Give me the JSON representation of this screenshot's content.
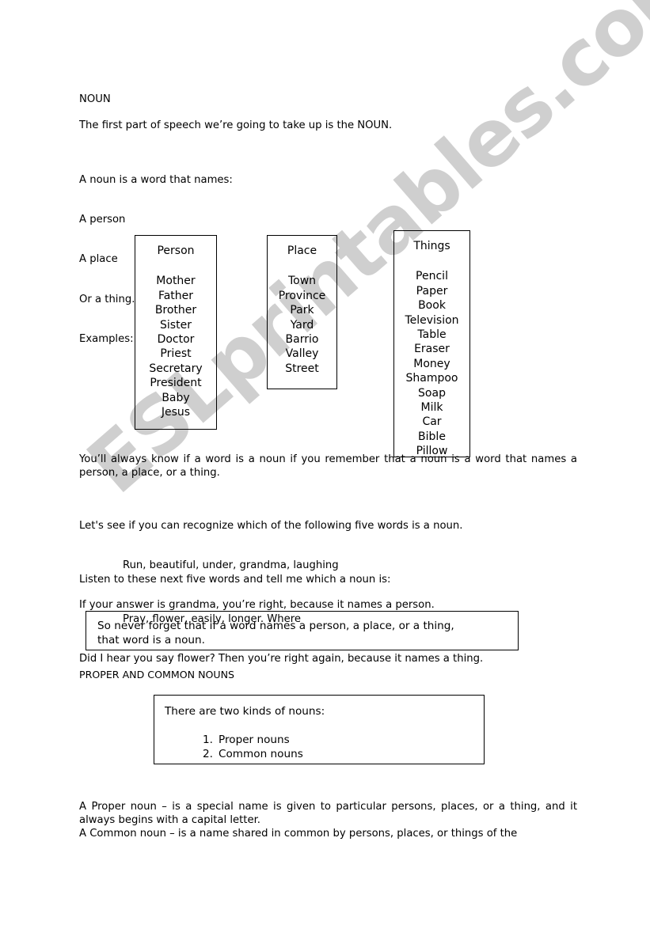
{
  "document": {
    "heading": "NOUN",
    "intro_line": "The first part of speech we’re going to take up is the NOUN.",
    "definition_lines": [
      "A noun is a word that names:",
      "A person",
      "A place",
      "Or a thing.",
      "Examples:"
    ]
  },
  "boxes": [
    {
      "title": "Person",
      "items": [
        "Mother",
        "Father",
        "Brother",
        "Sister",
        "Doctor",
        "Priest",
        "Secretary",
        "President",
        "Baby",
        "Jesus"
      ]
    },
    {
      "title": "Place",
      "items": [
        "Town",
        "Province",
        "Park",
        "Yard",
        "Barrio",
        "Valley",
        "Street"
      ]
    },
    {
      "title": "Things",
      "items": [
        "Pencil",
        "Paper",
        "Book",
        "Television",
        "Table",
        "Eraser",
        "Money",
        "Shampoo",
        "Soap",
        "Milk",
        "Car",
        "Bible",
        "Pillow"
      ]
    }
  ],
  "body": {
    "reminder": "You’ll always know if a word is a noun if you remember that a noun is a word that names a person, a place, or a thing.",
    "exercise1_prompt": "Let's see if you can recognize which of the following five words is a noun.",
    "exercise1_words": "Run, beautiful, under, grandma, laughing",
    "exercise1_answer": "If your answer is grandma, you’re right, because it names a person.",
    "exercise2_prompt": "Listen to these next five words and tell me which a noun is:",
    "exercise2_words": "Pray, flower, easily, longer. Where",
    "exercise2_answer": "Did I hear you say flower? Then you’re right again, because it names a thing."
  },
  "callout": {
    "line1": "So never forget that if a word names a person, a place, or a thing,",
    "line2": "that word is a noun."
  },
  "section2": {
    "heading": "PROPER AND COMMON NOUNS",
    "kinds_box": {
      "head": "There are two kinds of nouns:",
      "items": [
        {
          "num": "1.",
          "label": "Proper nouns"
        },
        {
          "num": "2.",
          "label": "Common nouns"
        }
      ]
    },
    "proper_noun_def": "A Proper noun – is a special name is given to particular persons, places, or a thing, and it always begins with a capital letter.",
    "common_noun_def": "A Common noun – is a name shared in common by persons, places, or things of the"
  },
  "watermark": {
    "text": "ESLprintables.com",
    "color": "#cfcfcf"
  }
}
